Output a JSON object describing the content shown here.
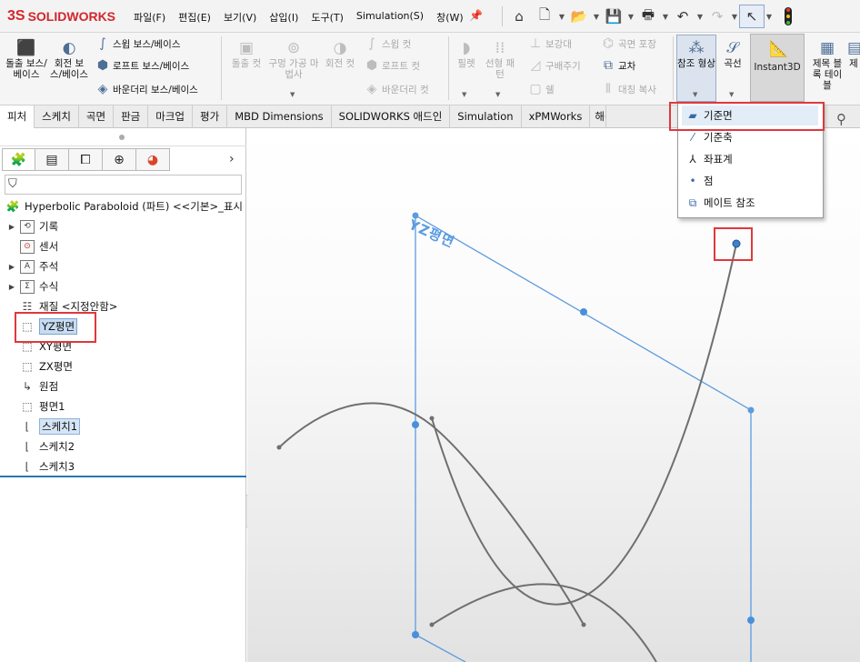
{
  "app": {
    "logo_mark": "3S",
    "logo_text": "SOLIDWORKS"
  },
  "menu": [
    "파일(F)",
    "편집(E)",
    "보기(V)",
    "삽입(I)",
    "도구(T)",
    "Simulation(S)",
    "창(W)"
  ],
  "ribbon": {
    "features": {
      "extrude_boss": "돌출 보스/베이스",
      "revolve_boss": "회전 보스/베이스",
      "sweep_boss": "스윕 보스/베이스",
      "loft_boss": "로프트 보스/베이스",
      "boundary_boss": "바운더리 보스/베이스",
      "extrude_cut": "돌출 컷",
      "hole_wizard": "구멍 가공 마법사",
      "revolve_cut": "회전 컷",
      "sweep_cut": "스윕 컷",
      "loft_cut": "로프트 컷",
      "boundary_cut": "바운더리 컷",
      "fillet": "필렛",
      "linear_pattern": "선형 패턴",
      "rib": "보강대",
      "draft": "구배주기",
      "shell": "쉘",
      "wrap": "곡면 포장",
      "intersect": "교차",
      "mirror": "대칭 복사",
      "ref_geometry": "참조 형상",
      "curves": "곡선",
      "instant3d": "Instant3D",
      "title_block": "제목 블록 테이블",
      "extra": "제"
    }
  },
  "tabs": [
    "피처",
    "스케치",
    "곡면",
    "판금",
    "마크업",
    "평가",
    "MBD Dimensions",
    "SOLIDWORKS 애드인",
    "Simulation",
    "xPMWorks",
    "해석"
  ],
  "tree": {
    "part": "Hyperbolic Paraboloid (파트) <<기본>_표시",
    "history": "기록",
    "sensors": "센서",
    "annotations": "주석",
    "equations": "수식",
    "material": "재질 <지정안함>",
    "yz_plane": "YZ평면",
    "xy_plane": "XY평면",
    "zx_plane": "ZX평면",
    "origin": "원점",
    "plane1": "평면1",
    "sketch1": "스케치1",
    "sketch2": "스케치2",
    "sketch3": "스케치3"
  },
  "dropdown": {
    "items": [
      "기준면",
      "기준축",
      "좌표계",
      "점",
      "메이트 참조"
    ]
  },
  "viewport": {
    "plane_label": "YZ평면"
  },
  "colors": {
    "plane_edge": "#5b9be0",
    "curve": "#6f6f6f",
    "highlight": "#e0383c",
    "selection": "#c7dcf2"
  }
}
